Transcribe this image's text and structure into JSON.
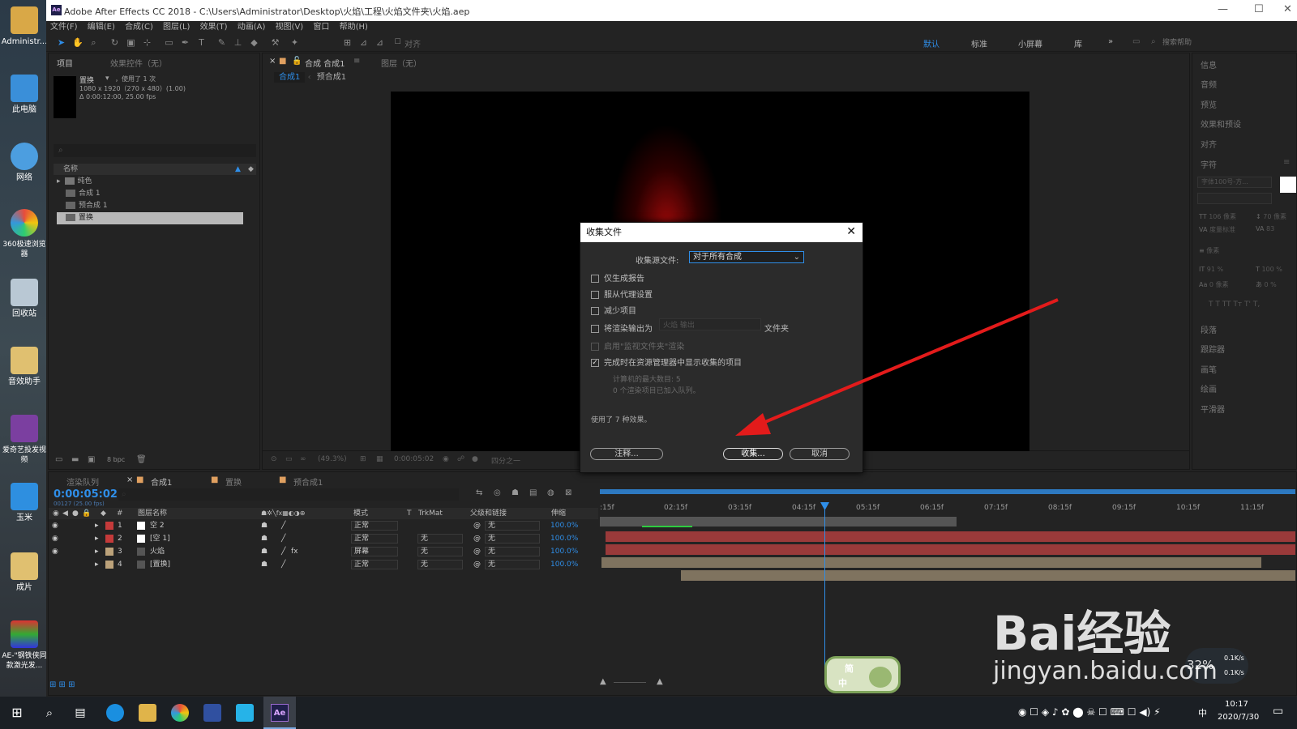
{
  "desktop": {
    "icons": [
      "Administr...",
      "此电脑",
      "网络",
      "360极速浏览器",
      "回收站",
      "音效助手",
      "爱奇艺投发视频",
      "玉米",
      "成片",
      "AE-\"钢铁侠同款激光发..."
    ]
  },
  "window": {
    "title": "Adobe After Effects CC 2018 - C:\\Users\\Administrator\\Desktop\\火焰\\工程\\火焰文件夹\\火焰.aep",
    "minimize": "—",
    "maximize": "☐",
    "close": "✕"
  },
  "menu": [
    "文件(F)",
    "编辑(E)",
    "合成(C)",
    "图层(L)",
    "效果(T)",
    "动画(A)",
    "视图(V)",
    "窗口",
    "帮助(H)"
  ],
  "toolbar": {
    "snap_label": "对齐",
    "workspaces": [
      "默认",
      "标准",
      "小屏幕",
      "库"
    ],
    "search_placeholder": "搜索帮助"
  },
  "project_panel": {
    "tabs": [
      "项目",
      "效果控件（无）"
    ],
    "selected_name": "置换",
    "used_count": "，使用了 1 次",
    "info_line1": "1080 x 1920（270 x 480）(1.00)",
    "info_line2": "Δ 0:00:12:00, 25.00 fps",
    "col_name": "名称",
    "items": [
      "纯色",
      "合成 1",
      "预合成 1",
      "置换"
    ],
    "bpc": "8 bpc"
  },
  "viewer": {
    "tab_comp": "合成 合成1",
    "tab_layer": "图层（无）",
    "crumb1": "合成1",
    "crumb2": "预合成1",
    "zoom": "(49.3%)",
    "time": "0:00:05:02",
    "res": "四分之一"
  },
  "right_panel": {
    "items": [
      "信息",
      "音频",
      "预览",
      "效果和预设",
      "对齐",
      "字符",
      "段落",
      "跟踪器",
      "画笔",
      "绘画",
      "平滑器"
    ],
    "font": "字体100号-方...",
    "size1": "106 像素",
    "size2": "70 像素",
    "leading": "度量标准",
    "tracking": "83",
    "stroke": "像素",
    "scale_v": "91 %",
    "scale_h": "100 %",
    "baseline": "0 像素",
    "tsume": "0 %",
    "styles": "T T TT Tт T' T,"
  },
  "dialog": {
    "title": "收集文件",
    "close": "✕",
    "source_label": "收集源文件:",
    "source_value": "对于所有合成",
    "opt1": "仅生成报告",
    "opt2": "服从代理设置",
    "opt3": "减少项目",
    "opt4": "将渲染输出为",
    "opt4_value": "火焰 输出",
    "opt4_suffix": "文件夹",
    "opt5": "启用\"监视文件夹\"渲染",
    "opt6": "完成时在资源管理器中显示收集的项目",
    "note1": "计算机的最大数目: 5",
    "note2": "0 个渲染项目已加入队列。",
    "effects_used": "使用了 7 种效果。",
    "btn_comment": "注释...",
    "btn_collect": "收集...",
    "btn_cancel": "取消"
  },
  "timeline": {
    "tabs": [
      "渲染队列",
      "合成1",
      "置换",
      "预合成1"
    ],
    "timecode": "0:00:05:02",
    "timecode_sub": "00127 (25.00 fps)",
    "col_layer_name": "图层名称",
    "col_mode": "模式",
    "col_t": "T",
    "col_trkmat": "TrkMat",
    "col_parent": "父级和链接",
    "col_stretch": "伸缩",
    "layers": [
      {
        "num": "1",
        "name": "空 2",
        "mode": "正常",
        "trkmat": "",
        "parent": "无",
        "stretch": "100.0%",
        "color": "#c43a3a"
      },
      {
        "num": "2",
        "name": "[空 1]",
        "mode": "正常",
        "trkmat": "无",
        "parent": "无",
        "stretch": "100.0%",
        "color": "#c43a3a"
      },
      {
        "num": "3",
        "name": "火焰",
        "mode": "屏幕",
        "trkmat": "无",
        "parent": "无",
        "stretch": "100.0%",
        "color": "#bca27a"
      },
      {
        "num": "4",
        "name": "[置换]",
        "mode": "正常",
        "trkmat": "无",
        "parent": "无",
        "stretch": "100.0%",
        "color": "#bca27a"
      }
    ],
    "ticks": [
      ":15f",
      "02:15f",
      "03:15f",
      "04:15f",
      "05:15f",
      "06:15f",
      "07:15f",
      "08:15f",
      "09:15f",
      "10:15f",
      "11:15f"
    ]
  },
  "ime": {
    "line1": "简",
    "line2": "中"
  },
  "net": {
    "pct": "32%",
    "up": "0.1K/s",
    "down": "0.1K/s"
  },
  "watermark": {
    "brand": "Bai经验",
    "url": "jingyan.baidu.com"
  },
  "taskbar": {
    "time": "10:17",
    "date": "2020/7/30",
    "ime_char": "中",
    "ae_label": "Ae"
  }
}
